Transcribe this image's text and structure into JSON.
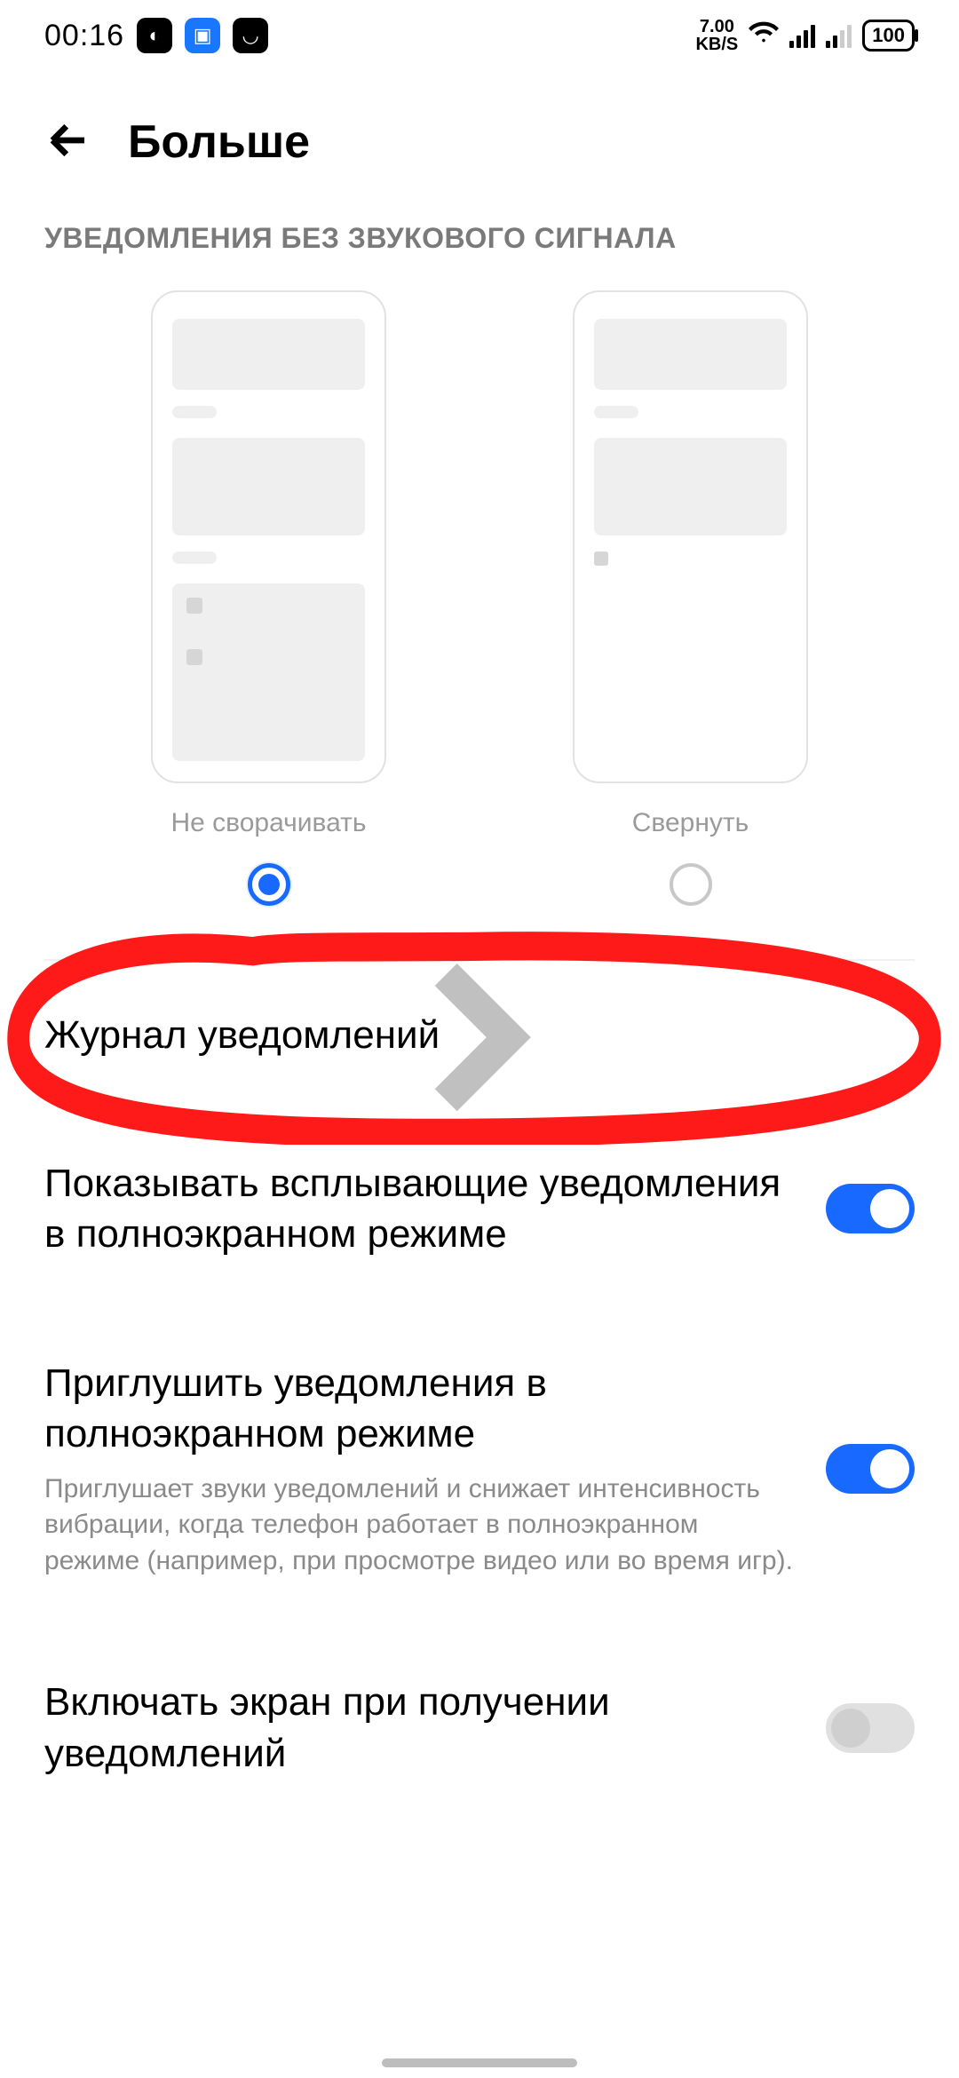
{
  "statusbar": {
    "time": "00:16",
    "net_speed_val": "7.00",
    "net_speed_unit": "KB/S",
    "battery": "100"
  },
  "header": {
    "title": "Больше"
  },
  "silent_section": {
    "title": "УВЕДОМЛЕНИЯ БЕЗ ЗВУКОВОГО СИГНАЛА",
    "options": [
      {
        "label": "Не сворачивать",
        "selected": true
      },
      {
        "label": "Свернуть",
        "selected": false
      }
    ]
  },
  "rows": {
    "history": {
      "title": "Журнал уведомлений"
    },
    "show_floating": {
      "title": "Показывать всплывающие уведомления в полноэкранном режиме",
      "on": true
    },
    "mute_fullscreen": {
      "title": "Приглушить уведомления в полноэкранном режиме",
      "desc": "Приглушает звуки уведомлений и снижает интенсивность вибрации, когда телефон работает в полноэкранном режиме (например, при просмотре видео или во время игр).",
      "on": true
    },
    "wake_screen": {
      "title": "Включать экран при получении уведомлений",
      "on": false
    }
  }
}
